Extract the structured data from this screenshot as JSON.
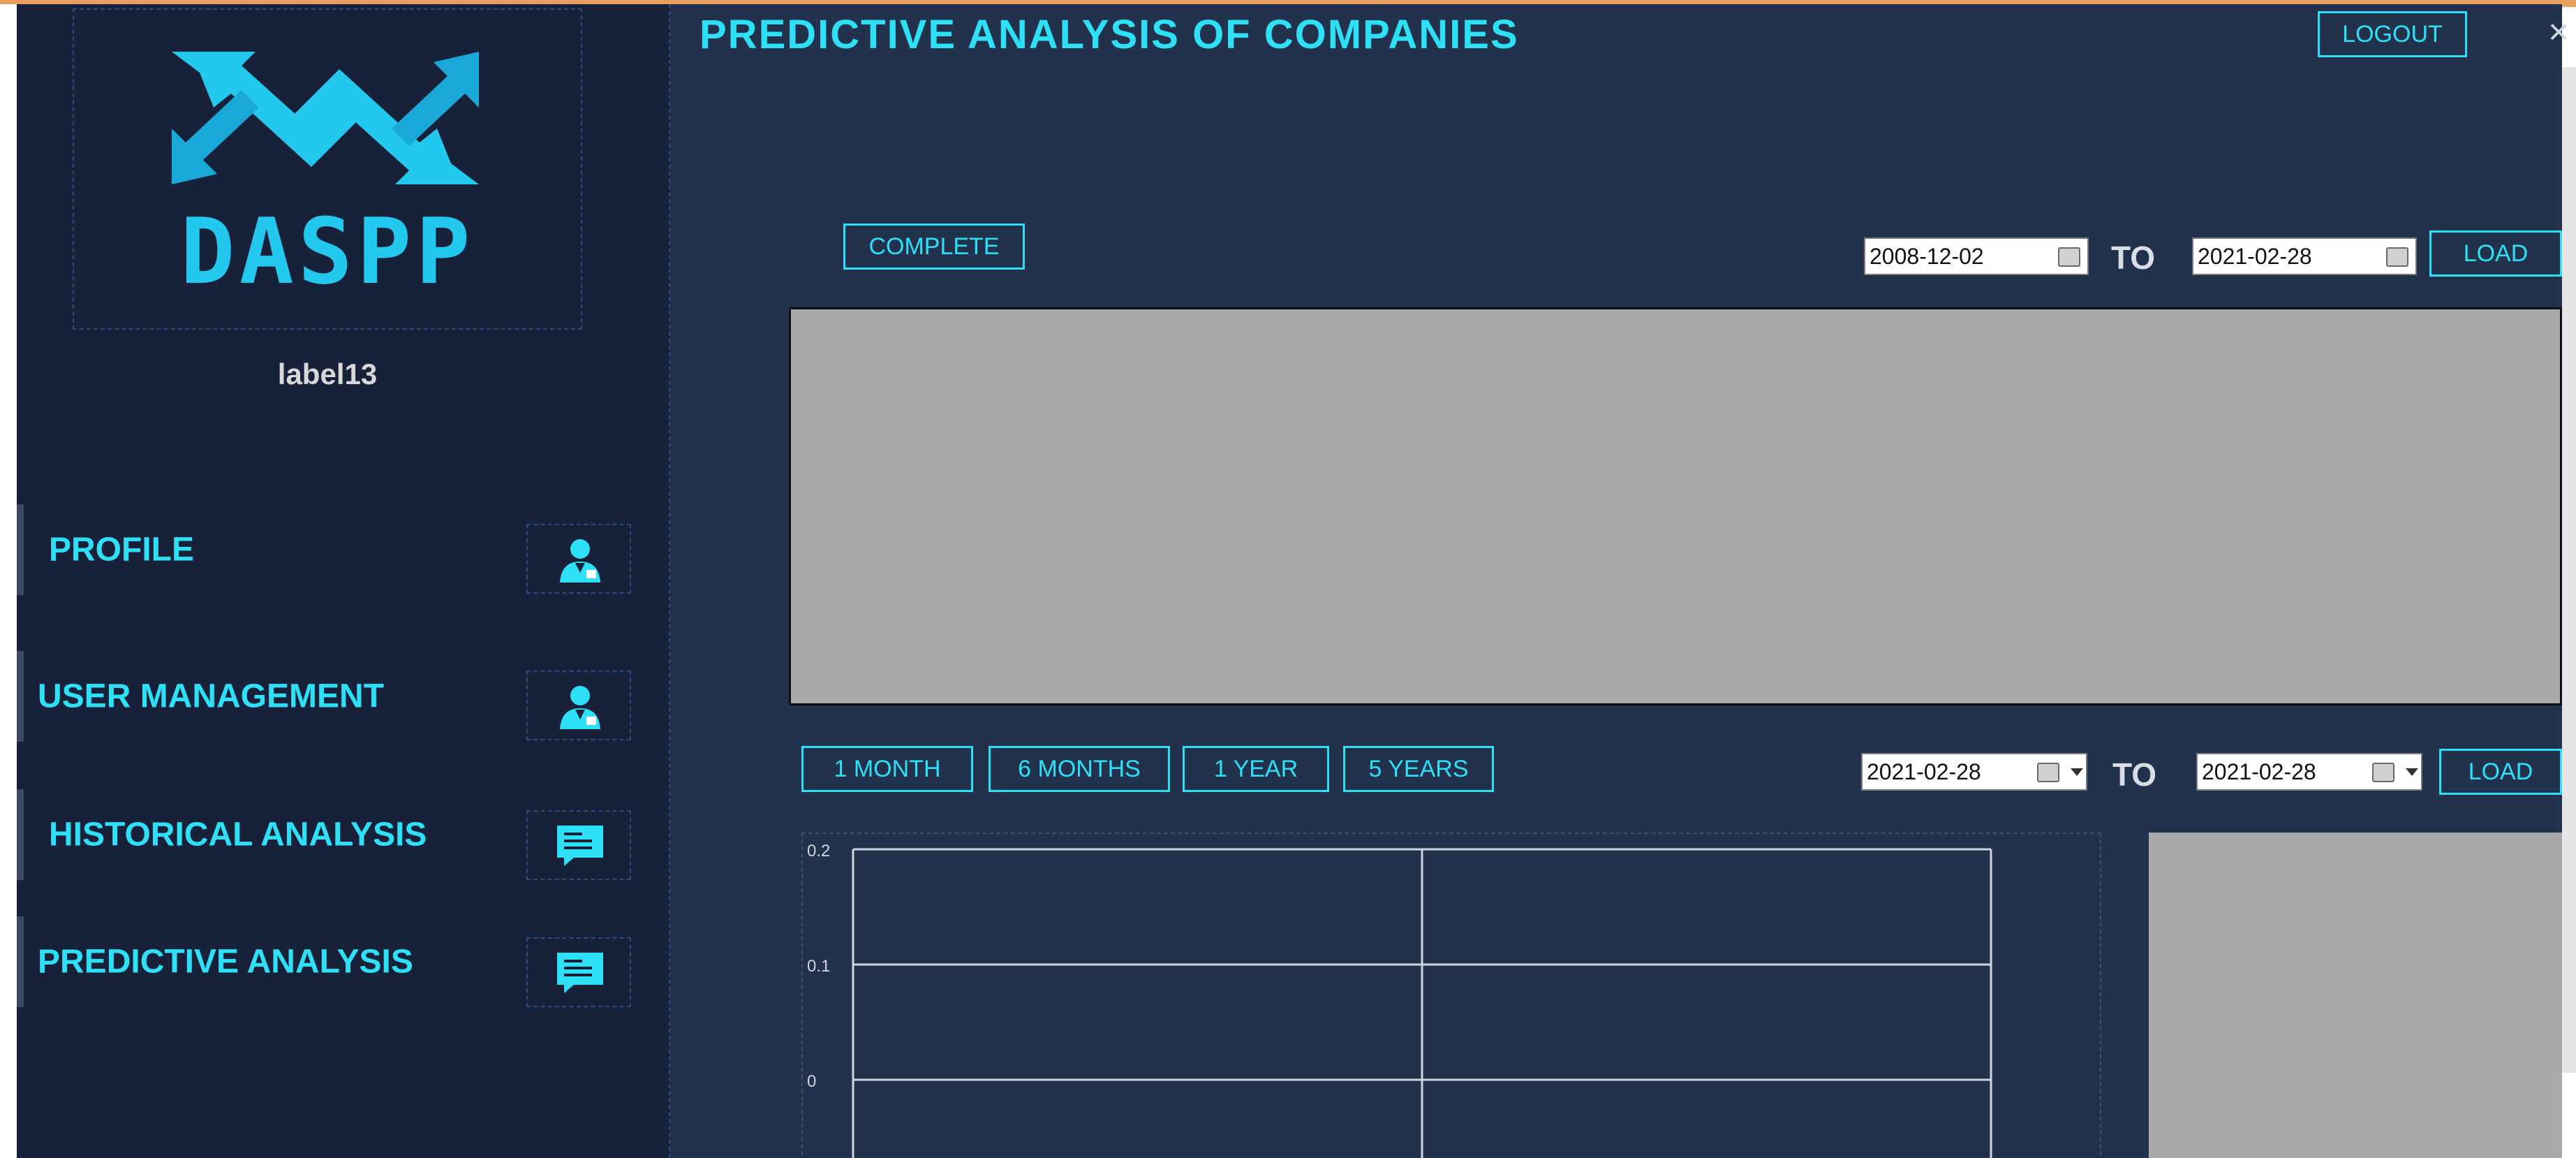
{
  "app": {
    "logo_text": "DASPP",
    "user_label": "label13",
    "page_title": "PREDICTIVE ANALYSIS OF COMPANIES",
    "logout_label": "LOGOUT",
    "close_glyph": "×"
  },
  "sidebar": {
    "items": [
      {
        "label": "PROFILE",
        "icon": "user-icon"
      },
      {
        "label": "USER MANAGEMENT",
        "icon": "user-icon"
      },
      {
        "label": "HISTORICAL ANALYSIS",
        "icon": "message-icon"
      },
      {
        "label": "PREDICTIVE ANALYSIS",
        "icon": "message-icon"
      }
    ]
  },
  "top_section": {
    "complete_label": "COMPLETE",
    "from_date": "2008-12-02",
    "to_label": "TO",
    "to_date": "2021-02-28",
    "load_label": "LOAD"
  },
  "bottom_section": {
    "range_buttons": [
      "1 MONTH",
      "6 MONTHS",
      "1 YEAR",
      "5 YEARS"
    ],
    "from_date": "2021-02-28",
    "to_label": "TO",
    "to_date": "2021-02-28",
    "load_label": "LOAD"
  },
  "colors": {
    "accent": "#2ee0f5",
    "sidebar_bg": "#18213a",
    "main_bg": "#22314c",
    "panel_gray": "#aaaaaa"
  },
  "chart_data": {
    "type": "line",
    "title": "",
    "xlabel": "",
    "ylabel": "",
    "y_ticks": [
      "0.2",
      "0.1",
      "0"
    ],
    "ylim": [
      0,
      0.2
    ],
    "grid": true,
    "series": []
  }
}
